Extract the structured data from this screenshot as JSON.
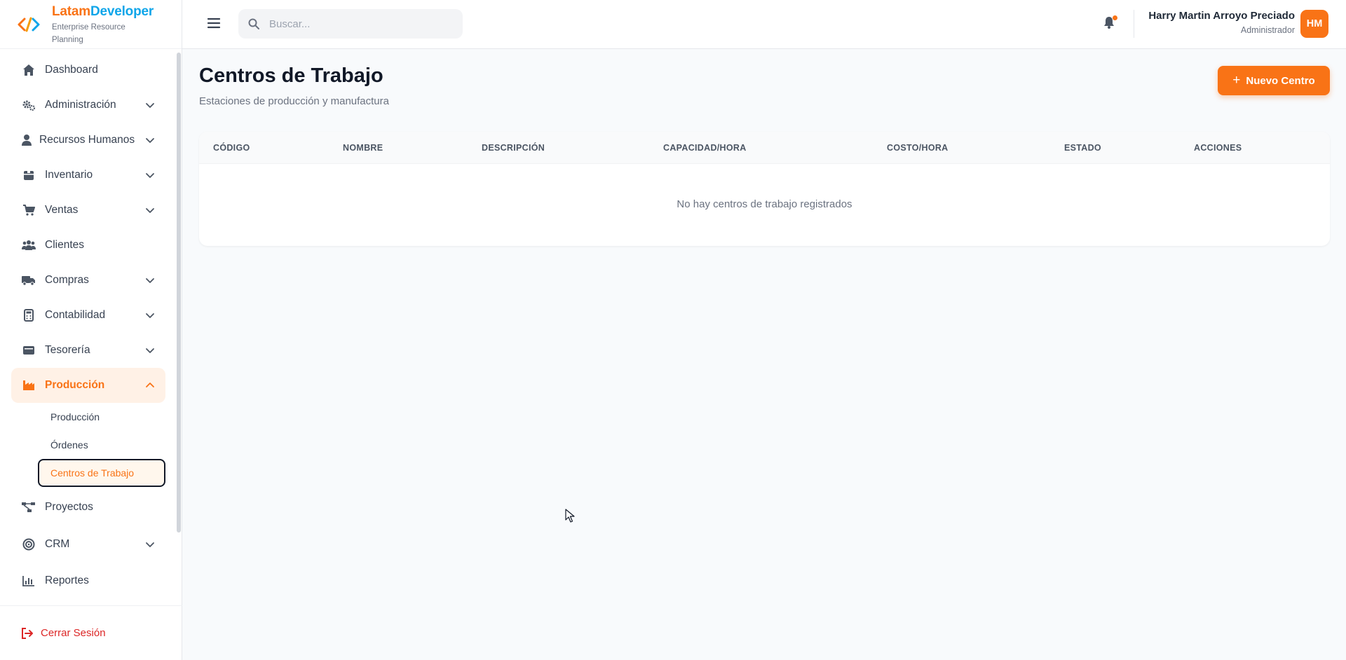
{
  "brand": {
    "name_part1": "Latam",
    "name_part2": "Developer",
    "subtitle": "Enterprise Resource Planning"
  },
  "sidebar": {
    "items": [
      {
        "label": "Dashboard",
        "icon": "home-icon"
      },
      {
        "label": "Administración",
        "icon": "gears-icon"
      },
      {
        "label": "Recursos Humanos",
        "icon": "user-tie-icon"
      },
      {
        "label": "Inventario",
        "icon": "box-icon"
      },
      {
        "label": "Ventas",
        "icon": "cart-icon"
      },
      {
        "label": "Clientes",
        "icon": "users-icon"
      },
      {
        "label": "Compras",
        "icon": "truck-icon"
      },
      {
        "label": "Contabilidad",
        "icon": "calculator-icon"
      },
      {
        "label": "Tesorería",
        "icon": "wallet-icon"
      },
      {
        "label": "Producción",
        "icon": "industry-icon"
      },
      {
        "label": "Proyectos",
        "icon": "project-diagram-icon"
      },
      {
        "label": "CRM",
        "icon": "target-icon"
      },
      {
        "label": "Reportes",
        "icon": "bar-chart-icon"
      }
    ],
    "subitems": [
      {
        "label": "Producción"
      },
      {
        "label": "Órdenes"
      },
      {
        "label": "Centros de Trabajo"
      }
    ],
    "logout_label": "Cerrar Sesión"
  },
  "header": {
    "search_placeholder": "Buscar...",
    "user_name": "Harry Martin Arroyo Preciado",
    "user_role": "Administrador",
    "avatar_initials": "HM"
  },
  "main": {
    "title": "Centros de Trabajo",
    "subtitle": "Estaciones de producción y manufactura",
    "new_button_label": "Nuevo Centro",
    "table": {
      "columns": [
        "CÓDIGO",
        "NOMBRE",
        "DESCRIPCIÓN",
        "CAPACIDAD/HORA",
        "COSTO/HORA",
        "ESTADO",
        "ACCIONES"
      ],
      "empty_message": "No hay centros de trabajo registrados"
    }
  },
  "colors": {
    "accent": "#f97316",
    "brand_blue": "#0ea5e9",
    "danger": "#dc2626"
  }
}
